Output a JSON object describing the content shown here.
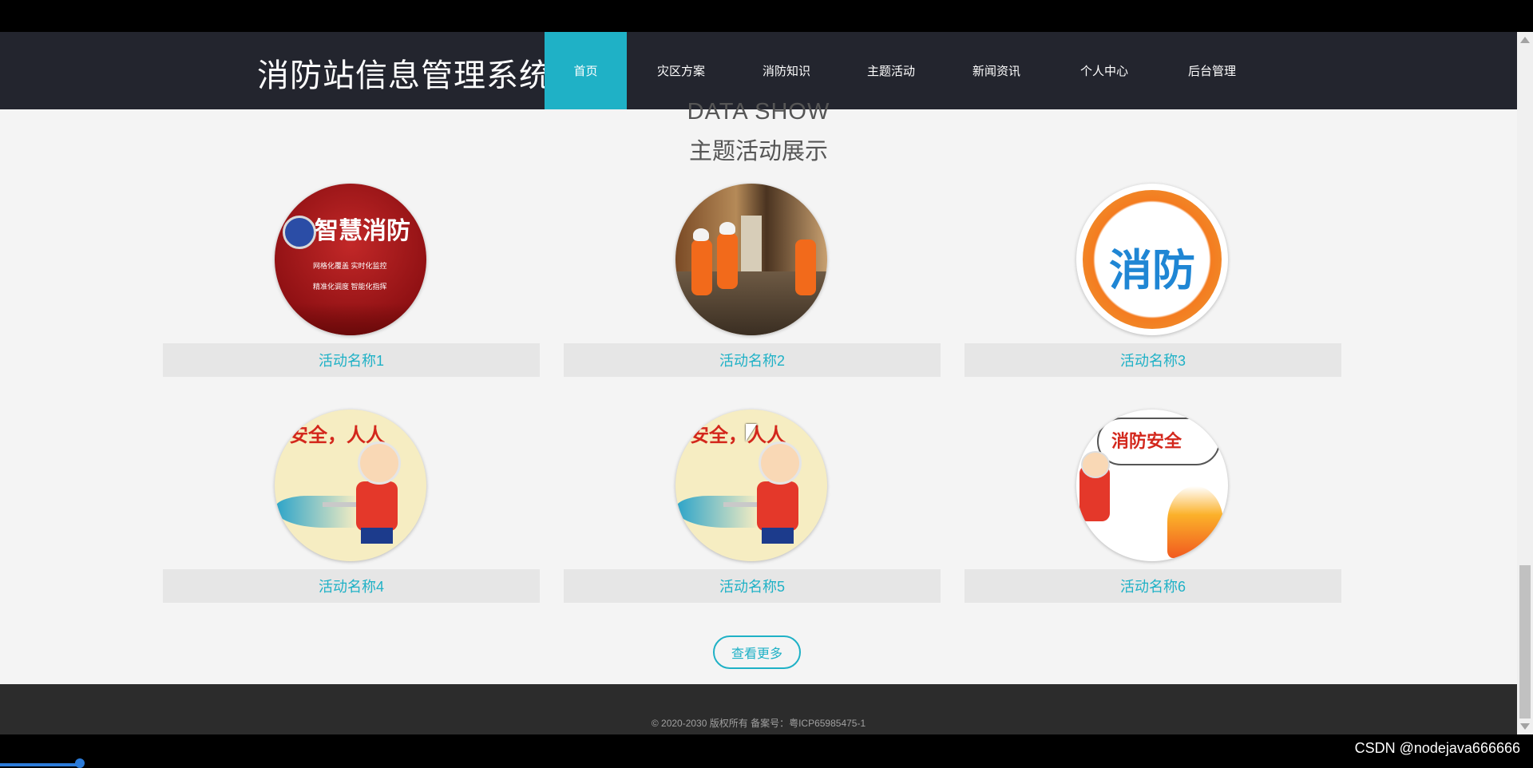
{
  "header": {
    "site_title": "消防站信息管理系统",
    "nav": [
      {
        "label": "首页",
        "active": true
      },
      {
        "label": "灾区方案",
        "active": false
      },
      {
        "label": "消防知识",
        "active": false
      },
      {
        "label": "主题活动",
        "active": false
      },
      {
        "label": "新闻资讯",
        "active": false
      },
      {
        "label": "个人中心",
        "active": false
      },
      {
        "label": "后台管理",
        "active": false
      }
    ]
  },
  "section": {
    "title_en": "DATA SHOW",
    "title_zh": "主题活动展示"
  },
  "activities": [
    {
      "name": "活动名称1",
      "image": "smart-fire-banner",
      "image_text": "智慧消防",
      "image_sub1": "网格化覆盖  实时化监控",
      "image_sub2": "精准化调度  智能化指挥"
    },
    {
      "name": "活动名称2",
      "image": "firefighters-corridor"
    },
    {
      "name": "活动名称3",
      "image": "fire-logo",
      "image_text": "消防"
    },
    {
      "name": "活动名称4",
      "image": "cartoon-firefighter",
      "image_text": "消安全，人人"
    },
    {
      "name": "活动名称5",
      "image": "cartoon-firefighter",
      "image_text": "消安全，人人"
    },
    {
      "name": "活动名称6",
      "image": "fire-safety-cartoon",
      "image_text": "消防安全"
    }
  ],
  "more_button": "查看更多",
  "footer": {
    "text": "© 2020-2030 版权所有 备案号：粤ICP65985475-1"
  },
  "watermark": "CSDN @nodejava666666",
  "colors": {
    "accent": "#1fb1c6",
    "header_bg": "#23252e",
    "footer_bg": "#2c2c2c",
    "page_bg": "#f4f4f4"
  }
}
